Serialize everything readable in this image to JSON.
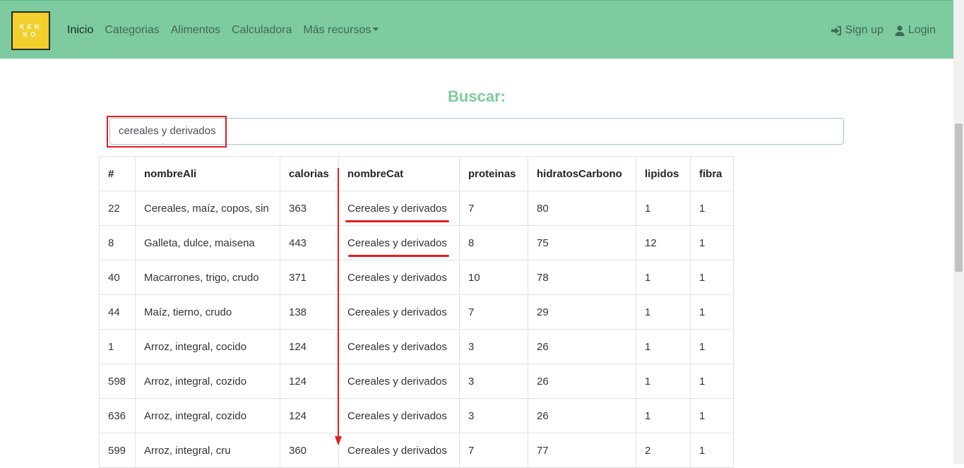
{
  "nav": {
    "logo_lines": [
      "KEN",
      "KO"
    ],
    "links": [
      "Inicio",
      "Categorias",
      "Alimentos",
      "Calculadora",
      "Más recursos"
    ],
    "signup": "Sign up",
    "login": "Login",
    "signup_icon": "sign-in-icon",
    "login_icon": "user-icon"
  },
  "search": {
    "title": "Buscar:",
    "value": "cereales y derivados"
  },
  "table": {
    "headers": [
      "#",
      "nombreAli",
      "calorias",
      "nombreCat",
      "proteinas",
      "hidratosCarbono",
      "lipidos",
      "fibra"
    ],
    "rows": [
      [
        "22",
        "Cereales, maíz, copos, sin",
        "363",
        "Cereales y derivados",
        "7",
        "80",
        "1",
        "1"
      ],
      [
        "8",
        "Galleta, dulce, maisena",
        "443",
        "Cereales y derivados",
        "8",
        "75",
        "12",
        "1"
      ],
      [
        "40",
        "Macarrones, trigo, crudo",
        "371",
        "Cereales y derivados",
        "10",
        "78",
        "1",
        "1"
      ],
      [
        "44",
        "Maíz, tierno, crudo",
        "138",
        "Cereales y derivados",
        "7",
        "29",
        "1",
        "1"
      ],
      [
        "1",
        "Arroz, integral, cocido",
        "124",
        "Cereales y derivados",
        "3",
        "26",
        "1",
        "1"
      ],
      [
        "598",
        "Arroz, integral, cozido",
        "124",
        "Cereales y derivados",
        "3",
        "26",
        "1",
        "1"
      ],
      [
        "636",
        "Arroz, integral, cozido",
        "124",
        "Cereales y derivados",
        "3",
        "26",
        "1",
        "1"
      ],
      [
        "599",
        "Arroz, integral, cru",
        "360",
        "Cereales y derivados",
        "7",
        "77",
        "2",
        "1"
      ]
    ]
  },
  "colors": {
    "navbar": "#7dcb9f",
    "accent": "#7dcb9f",
    "annotation": "#e31c1c"
  }
}
